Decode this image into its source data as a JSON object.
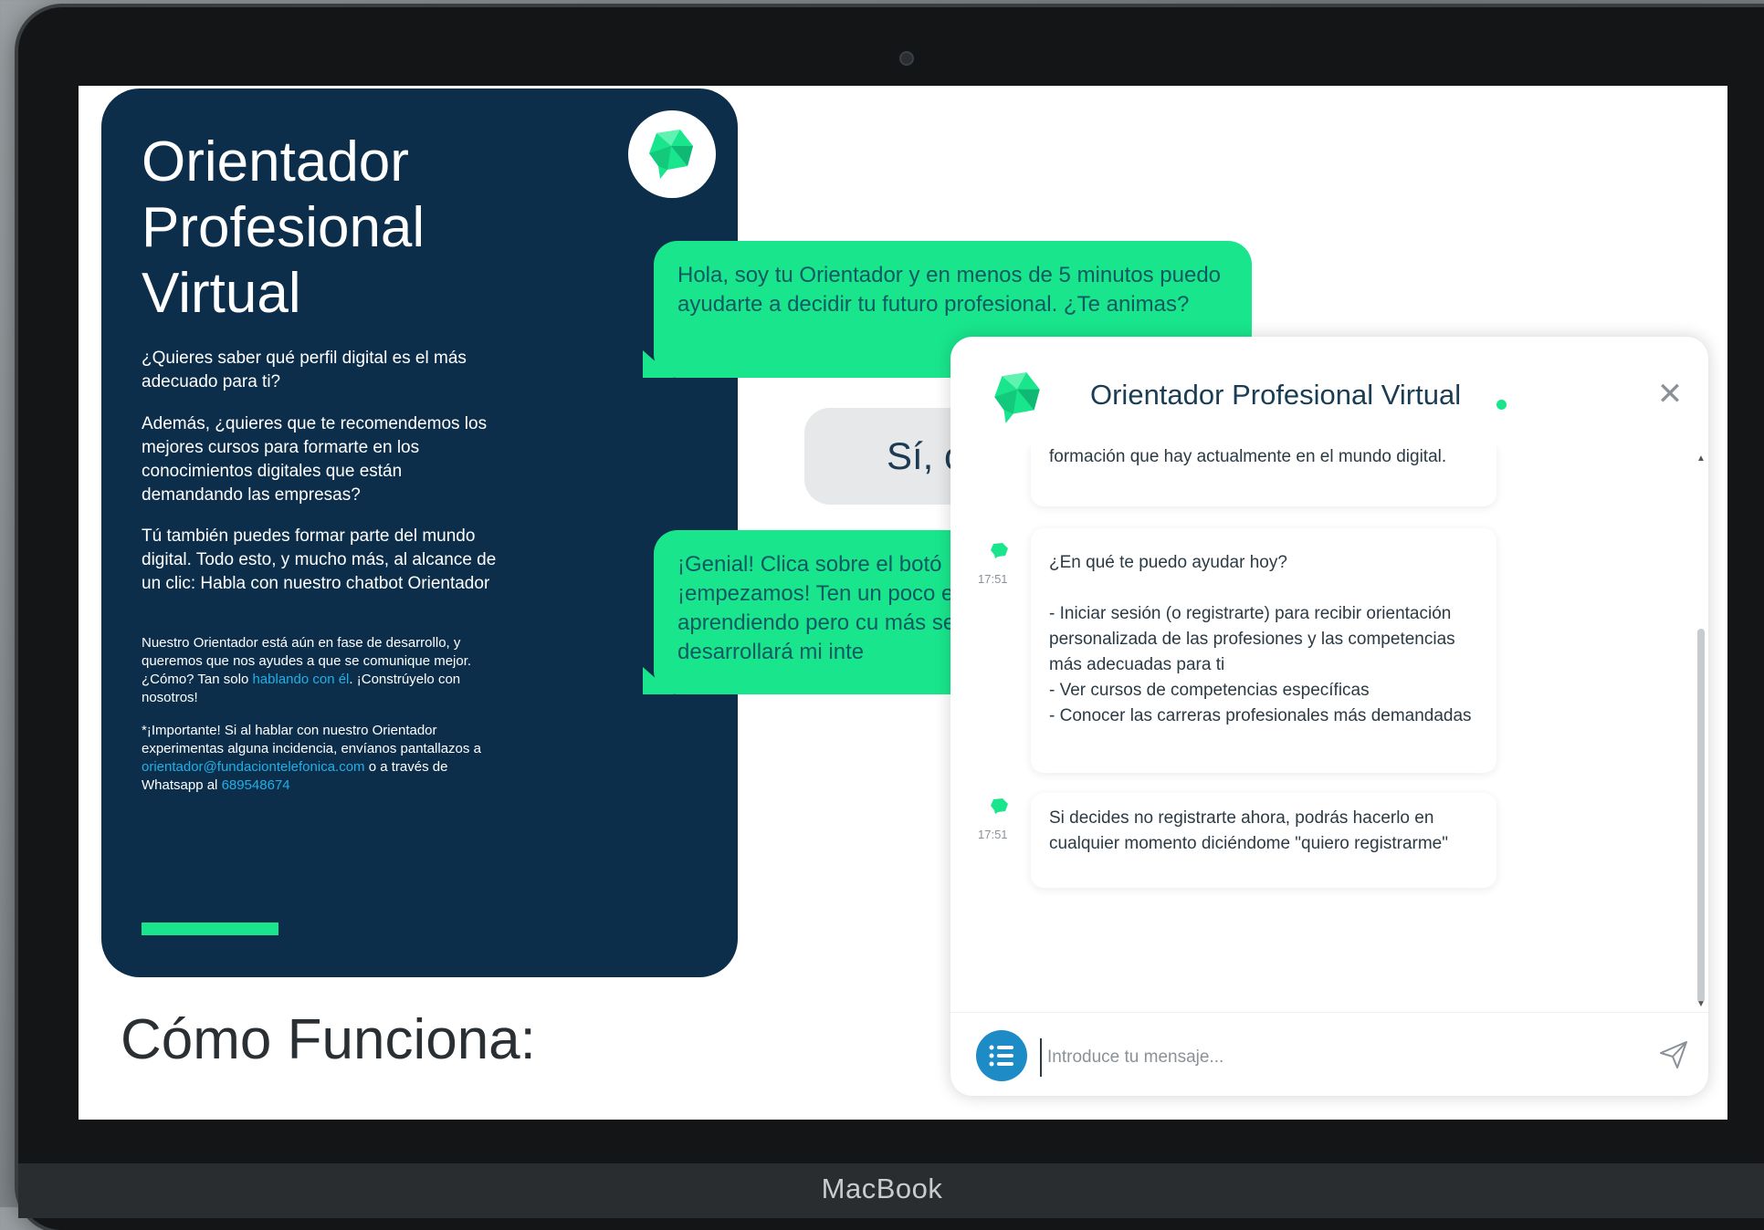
{
  "device_label": "MacBook",
  "hero": {
    "title_line1": "Orientador",
    "title_line2": "Profesional",
    "title_line3": "Virtual",
    "p1": "¿Quieres saber qué perfil digital es el más adecuado para ti?",
    "p2": "Además, ¿quieres que te recomendemos los mejores cursos para formarte en los conocimientos digitales que están demandando las empresas?",
    "p3": "Tú también puedes formar parte del mundo digital. Todo esto, y mucho más, al alcance de un clic: Habla con nuestro chatbot Orientador",
    "p4_text": "Nuestro Orientador está aún en fase de desarrollo, y queremos que nos ayudes a que se comunique mejor. ¿Cómo? Tan solo",
    "p4_link": "hablando con él",
    "p4_tail": ". ¡Constrúyelo con nosotros!",
    "p5_text": "*¡Importante! Si al hablar con nuestro Orientador experimentas alguna incidencia, envíanos pantallazos a",
    "p5_email": "orientador@fundaciontelefonica.com",
    "p5_mid": " o a través de Whatsapp al",
    "p5_phone": "689548674"
  },
  "how_it_works": "Cómo Funciona:",
  "bg_bubbles": {
    "greeting": "Hola, soy tu Orientador y en menos de 5 minutos puedo ayudarte a decidir tu futuro profesional. ¿Te animas?",
    "reply_button": "Sí, c",
    "second": "¡Genial! Clica sobre el botó ¡empezamos! Ten un poco estoy aprendiendo pero cu más se desarrollará mi inte"
  },
  "chat": {
    "title": "Orientador Profesional Virtual",
    "status": "online",
    "messages": [
      {
        "text": "formación que hay actualmente en el mundo digital."
      },
      {
        "time": "17:51",
        "text": "¿En qué te puedo ayudar hoy?\n\n- Iniciar sesión (o registrarte) para recibir orientación\npersonalizada de las profesiones y las competencias\nmás adecuadas para ti\n- Ver cursos de competencias específicas\n- Conocer las carreras profesionales más demandadas"
      },
      {
        "time": "17:51",
        "text": "Si decides no registrarte ahora, podrás hacerlo en cualquier momento diciéndome \"quiero registrarme\""
      }
    ],
    "input_placeholder": "Introduce tu mensaje..."
  },
  "colors": {
    "brand_navy": "#0c2e4a",
    "accent_green": "#19e68c",
    "link_blue": "#1fb0e8",
    "menu_blue": "#1c8bc6"
  }
}
